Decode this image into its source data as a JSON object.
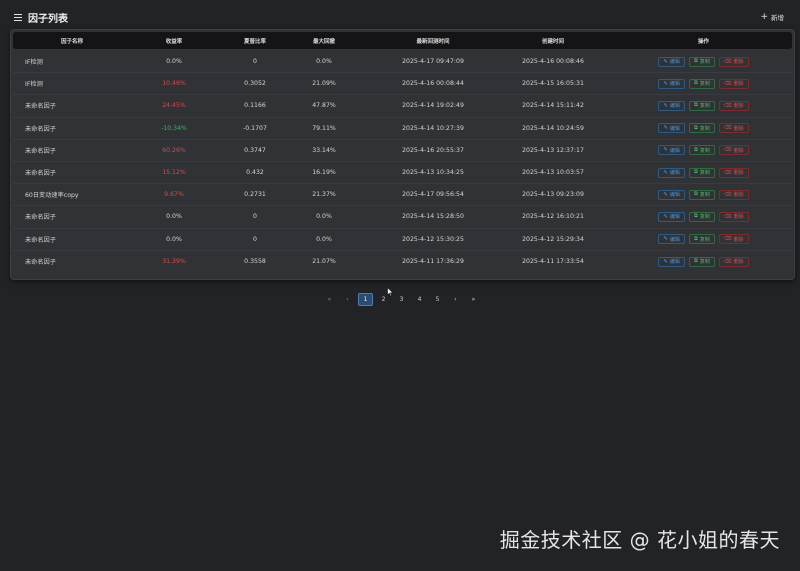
{
  "header": {
    "title": "因子列表",
    "add_label": "新增"
  },
  "table": {
    "columns": [
      "因子名称",
      "收益率",
      "夏普比率",
      "最大回撤",
      "最新回测时间",
      "创建时间",
      "操作"
    ],
    "rows": [
      {
        "name": "IF检测",
        "ret": "0.0%",
        "ret_sign": "zero",
        "sharpe": "0",
        "dd": "0.0%",
        "backtest": "2025-4-17 09:47:09",
        "created": "2025-4-16 00:08:46"
      },
      {
        "name": "IF检测",
        "ret": "10.46%",
        "ret_sign": "pos",
        "sharpe": "0.3052",
        "dd": "21.09%",
        "backtest": "2025-4-16 00:08:44",
        "created": "2025-4-15 16:05:31"
      },
      {
        "name": "未命名因子",
        "ret": "24.45%",
        "ret_sign": "pos",
        "sharpe": "0.1166",
        "dd": "47.87%",
        "backtest": "2025-4-14 19:02:49",
        "created": "2025-4-14 15:11:42"
      },
      {
        "name": "未命名因子",
        "ret": "-10.34%",
        "ret_sign": "neg",
        "sharpe": "-0.1707",
        "dd": "79.11%",
        "backtest": "2025-4-14 10:27:39",
        "created": "2025-4-14 10:24:59"
      },
      {
        "name": "未命名因子",
        "ret": "60.26%",
        "ret_sign": "pos",
        "sharpe": "0.3747",
        "dd": "33.14%",
        "backtest": "2025-4-16 20:55:37",
        "created": "2025-4-13 12:37:17"
      },
      {
        "name": "未命名因子",
        "ret": "15.12%",
        "ret_sign": "pos",
        "sharpe": "0.432",
        "dd": "16.19%",
        "backtest": "2025-4-13 10:34:25",
        "created": "2025-4-13 10:03:57"
      },
      {
        "name": "60日变动速率copy",
        "ret": "9.67%",
        "ret_sign": "pos",
        "sharpe": "0.2731",
        "dd": "21.37%",
        "backtest": "2025-4-17 09:56:54",
        "created": "2025-4-13 09:23:09"
      },
      {
        "name": "未命名因子",
        "ret": "0.0%",
        "ret_sign": "zero",
        "sharpe": "0",
        "dd": "0.0%",
        "backtest": "2025-4-14 15:28:50",
        "created": "2025-4-12 16:10:21"
      },
      {
        "name": "未命名因子",
        "ret": "0.0%",
        "ret_sign": "zero",
        "sharpe": "0",
        "dd": "0.0%",
        "backtest": "2025-4-12 15:30:25",
        "created": "2025-4-12 15:29:34"
      },
      {
        "name": "未命名因子",
        "ret": "31.39%",
        "ret_sign": "pos",
        "sharpe": "0.3558",
        "dd": "21.07%",
        "backtest": "2025-4-11 17:36:29",
        "created": "2025-4-11 17:33:54"
      }
    ],
    "actions": {
      "edit": "编辑",
      "copy": "复制",
      "delete": "删除"
    }
  },
  "pagination": {
    "first": "«",
    "prev": "‹",
    "pages": [
      "1",
      "2",
      "3",
      "4",
      "5"
    ],
    "current": "1",
    "next": "›",
    "last": "»"
  },
  "watermark": "掘金技术社区 @ 花小姐的春天",
  "colors": {
    "positive": "#d84a4a",
    "negative": "#3fb25f",
    "active_page": "#2b4c6e",
    "edit": "#4a94d6",
    "copy": "#4fb46a",
    "delete": "#d84a4a"
  }
}
